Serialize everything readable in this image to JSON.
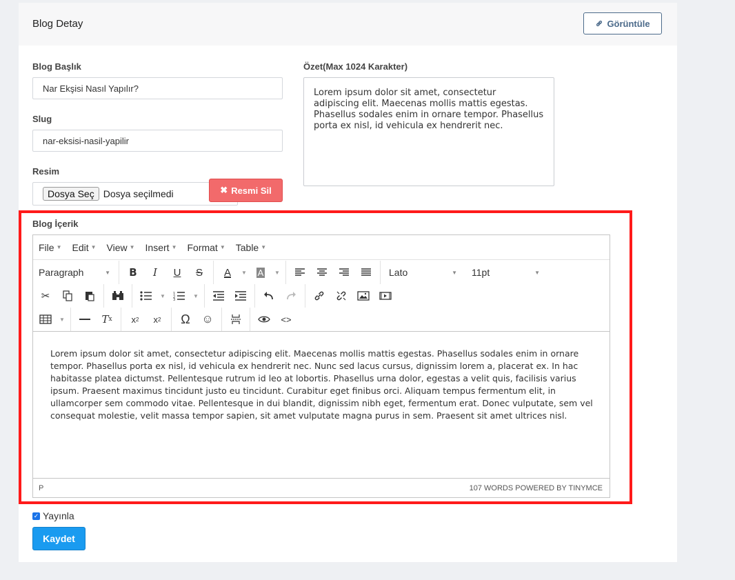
{
  "card": {
    "title": "Blog Detay",
    "view_button": "Görüntüle"
  },
  "form": {
    "title_label": "Blog Başlık",
    "title_value": "Nar Ekşisi Nasıl Yapılır?",
    "slug_label": "Slug",
    "slug_value": "nar-eksisi-nasil-yapilir",
    "image_label": "Resim",
    "file_button": "Dosya Seç",
    "file_status": "Dosya seçilmedi",
    "delete_image_button": "Resmi Sil",
    "summary_label": "Özet(Max 1024 Karakter)",
    "summary_value": "Lorem ipsum dolor sit amet, consectetur adipiscing elit. Maecenas mollis mattis egestas. Phasellus sodales enim in ornare tempor. Phasellus porta ex nisl, id vehicula ex hendrerit nec.",
    "content_label": "Blog İçerik",
    "publish_label": "Yayınla",
    "save_button": "Kaydet"
  },
  "editor": {
    "menu": [
      "File",
      "Edit",
      "View",
      "Insert",
      "Format",
      "Table"
    ],
    "block_format": "Paragraph",
    "font_family": "Lato",
    "font_size": "11pt",
    "content": "Lorem ipsum dolor sit amet, consectetur adipiscing elit. Maecenas mollis mattis egestas. Phasellus sodales enim in ornare tempor. Phasellus porta ex nisl, id vehicula ex hendrerit nec. Nunc sed lacus cursus, dignissim lorem a, placerat ex. In hac habitasse platea dictumst. Pellentesque rutrum id leo at lobortis. Phasellus urna dolor, egestas a velit quis, facilisis varius ipsum. Praesent maximus tincidunt justo eu tincidunt. Curabitur eget finibus orci. Aliquam tempus fermentum elit, in ullamcorper sem commodo vitae. Pellentesque in dui blandit, dignissim nibh eget, fermentum erat. Donec vulputate, sem vel consequat molestie, velit massa tempor sapien, sit amet vulputate magna purus in sem. Praesent sit amet ultrices nisl.",
    "path": "P",
    "status": "107 WORDS POWERED BY TINYMCE"
  },
  "colors": {
    "highlight": "#ff1a1a",
    "danger": "#f26a6b",
    "primary": "#1a9bf0",
    "outline": "#4b6a8a"
  }
}
